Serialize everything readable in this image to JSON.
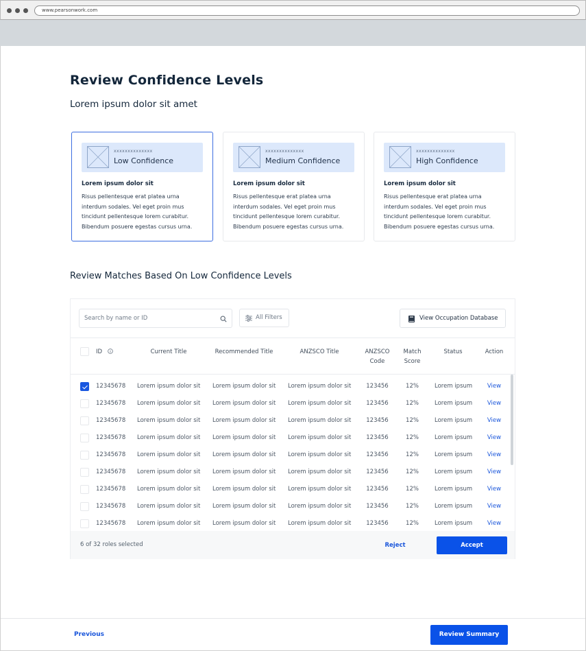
{
  "browser": {
    "url": "www.pearsonwork.com"
  },
  "page": {
    "title": "Review Confidence Levels",
    "subtitle": "Lorem ipsum dolor sit amet"
  },
  "cards": [
    {
      "tag": "xxxxxxxxxxxxxx",
      "label": "Low Confidence",
      "heading": "Lorem ipsum dolor sit",
      "body_lines": [
        "Risus pellentesque erat platea urna",
        "interdum sodales. Vel eget proin mus",
        "tincidunt pellentesque lorem curabitur.",
        "Bibendum posuere egestas cursus urna."
      ],
      "selected": true
    },
    {
      "tag": "xxxxxxxxxxxxxx",
      "label": "Medium Confidence",
      "heading": "Lorem ipsum dolor sit",
      "body_lines": [
        "Risus pellentesque erat platea urna",
        "interdum sodales. Vel eget proin mus",
        "tincidunt pellentesque lorem curabitur.",
        "Bibendum posuere egestas cursus urna."
      ],
      "selected": false
    },
    {
      "tag": "xxxxxxxxxxxxxx",
      "label": "High Confidence",
      "heading": "Lorem ipsum dolor sit",
      "body_lines": [
        "Risus pellentesque erat platea urna",
        "interdum sodales. Vel eget proin mus",
        "tincidunt pellentesque lorem curabitur.",
        "Bibendum posuere egestas cursus urna."
      ],
      "selected": false
    }
  ],
  "section": {
    "title": "Review Matches Based On Low Confidence Levels"
  },
  "toolbar": {
    "search_placeholder": "Search by name or ID",
    "filters_label": "All Filters",
    "view_db_label": "View Occupation Database"
  },
  "table": {
    "headers": {
      "id": "ID",
      "current_title": "Current Title",
      "recommended_title": "Recommended Title",
      "anzsco_title": "ANZSCO Title",
      "anzsco_code_1": "ANZSCO",
      "anzsco_code_2": "Code",
      "match_score_1": "Match",
      "match_score_2": "Score",
      "status": "Status",
      "action": "Action"
    },
    "rows": [
      {
        "checked": true,
        "id": "12345678",
        "current_title": "Lorem ipsum dolor sit",
        "recommended_title": "Lorem ipsum dolor sit",
        "anzsco_title": "Lorem ipsum dolor sit",
        "anzsco_code": "123456",
        "match_score": "12%",
        "status": "Lorem ipsum",
        "action": "View"
      },
      {
        "checked": false,
        "id": "12345678",
        "current_title": "Lorem ipsum dolor sit",
        "recommended_title": "Lorem ipsum dolor sit",
        "anzsco_title": "Lorem ipsum dolor sit",
        "anzsco_code": "123456",
        "match_score": "12%",
        "status": "Lorem ipsum",
        "action": "View"
      },
      {
        "checked": false,
        "id": "12345678",
        "current_title": "Lorem ipsum dolor sit",
        "recommended_title": "Lorem ipsum dolor sit",
        "anzsco_title": "Lorem ipsum dolor sit",
        "anzsco_code": "123456",
        "match_score": "12%",
        "status": "Lorem ipsum",
        "action": "View"
      },
      {
        "checked": false,
        "id": "12345678",
        "current_title": "Lorem ipsum dolor sit",
        "recommended_title": "Lorem ipsum dolor sit",
        "anzsco_title": "Lorem ipsum dolor sit",
        "anzsco_code": "123456",
        "match_score": "12%",
        "status": "Lorem ipsum",
        "action": "View"
      },
      {
        "checked": false,
        "id": "12345678",
        "current_title": "Lorem ipsum dolor sit",
        "recommended_title": "Lorem ipsum dolor sit",
        "anzsco_title": "Lorem ipsum dolor sit",
        "anzsco_code": "123456",
        "match_score": "12%",
        "status": "Lorem ipsum",
        "action": "View"
      },
      {
        "checked": false,
        "id": "12345678",
        "current_title": "Lorem ipsum dolor sit",
        "recommended_title": "Lorem ipsum dolor sit",
        "anzsco_title": "Lorem ipsum dolor sit",
        "anzsco_code": "123456",
        "match_score": "12%",
        "status": "Lorem ipsum",
        "action": "View"
      },
      {
        "checked": false,
        "id": "12345678",
        "current_title": "Lorem ipsum dolor sit",
        "recommended_title": "Lorem ipsum dolor sit",
        "anzsco_title": "Lorem ipsum dolor sit",
        "anzsco_code": "123456",
        "match_score": "12%",
        "status": "Lorem ipsum",
        "action": "View"
      },
      {
        "checked": false,
        "id": "12345678",
        "current_title": "Lorem ipsum dolor sit",
        "recommended_title": "Lorem ipsum dolor sit",
        "anzsco_title": "Lorem ipsum dolor sit",
        "anzsco_code": "123456",
        "match_score": "12%",
        "status": "Lorem ipsum",
        "action": "View"
      },
      {
        "checked": false,
        "id": "12345678",
        "current_title": "Lorem ipsum dolor sit",
        "recommended_title": "Lorem ipsum dolor sit",
        "anzsco_title": "Lorem ipsum dolor sit",
        "anzsco_code": "123456",
        "match_score": "12%",
        "status": "Lorem ipsum",
        "action": "View"
      }
    ]
  },
  "table_footer": {
    "selected_text": "6 of 32 roles selected",
    "reject_label": "Reject",
    "accept_label": "Accept"
  },
  "nav": {
    "previous_label": "Previous",
    "review_summary_label": "Review Summary"
  },
  "colors": {
    "accent": "#0a52e8",
    "link": "#1a56db",
    "card_banner": "#dce8fb",
    "selected_card_border": "#3c6de0"
  }
}
